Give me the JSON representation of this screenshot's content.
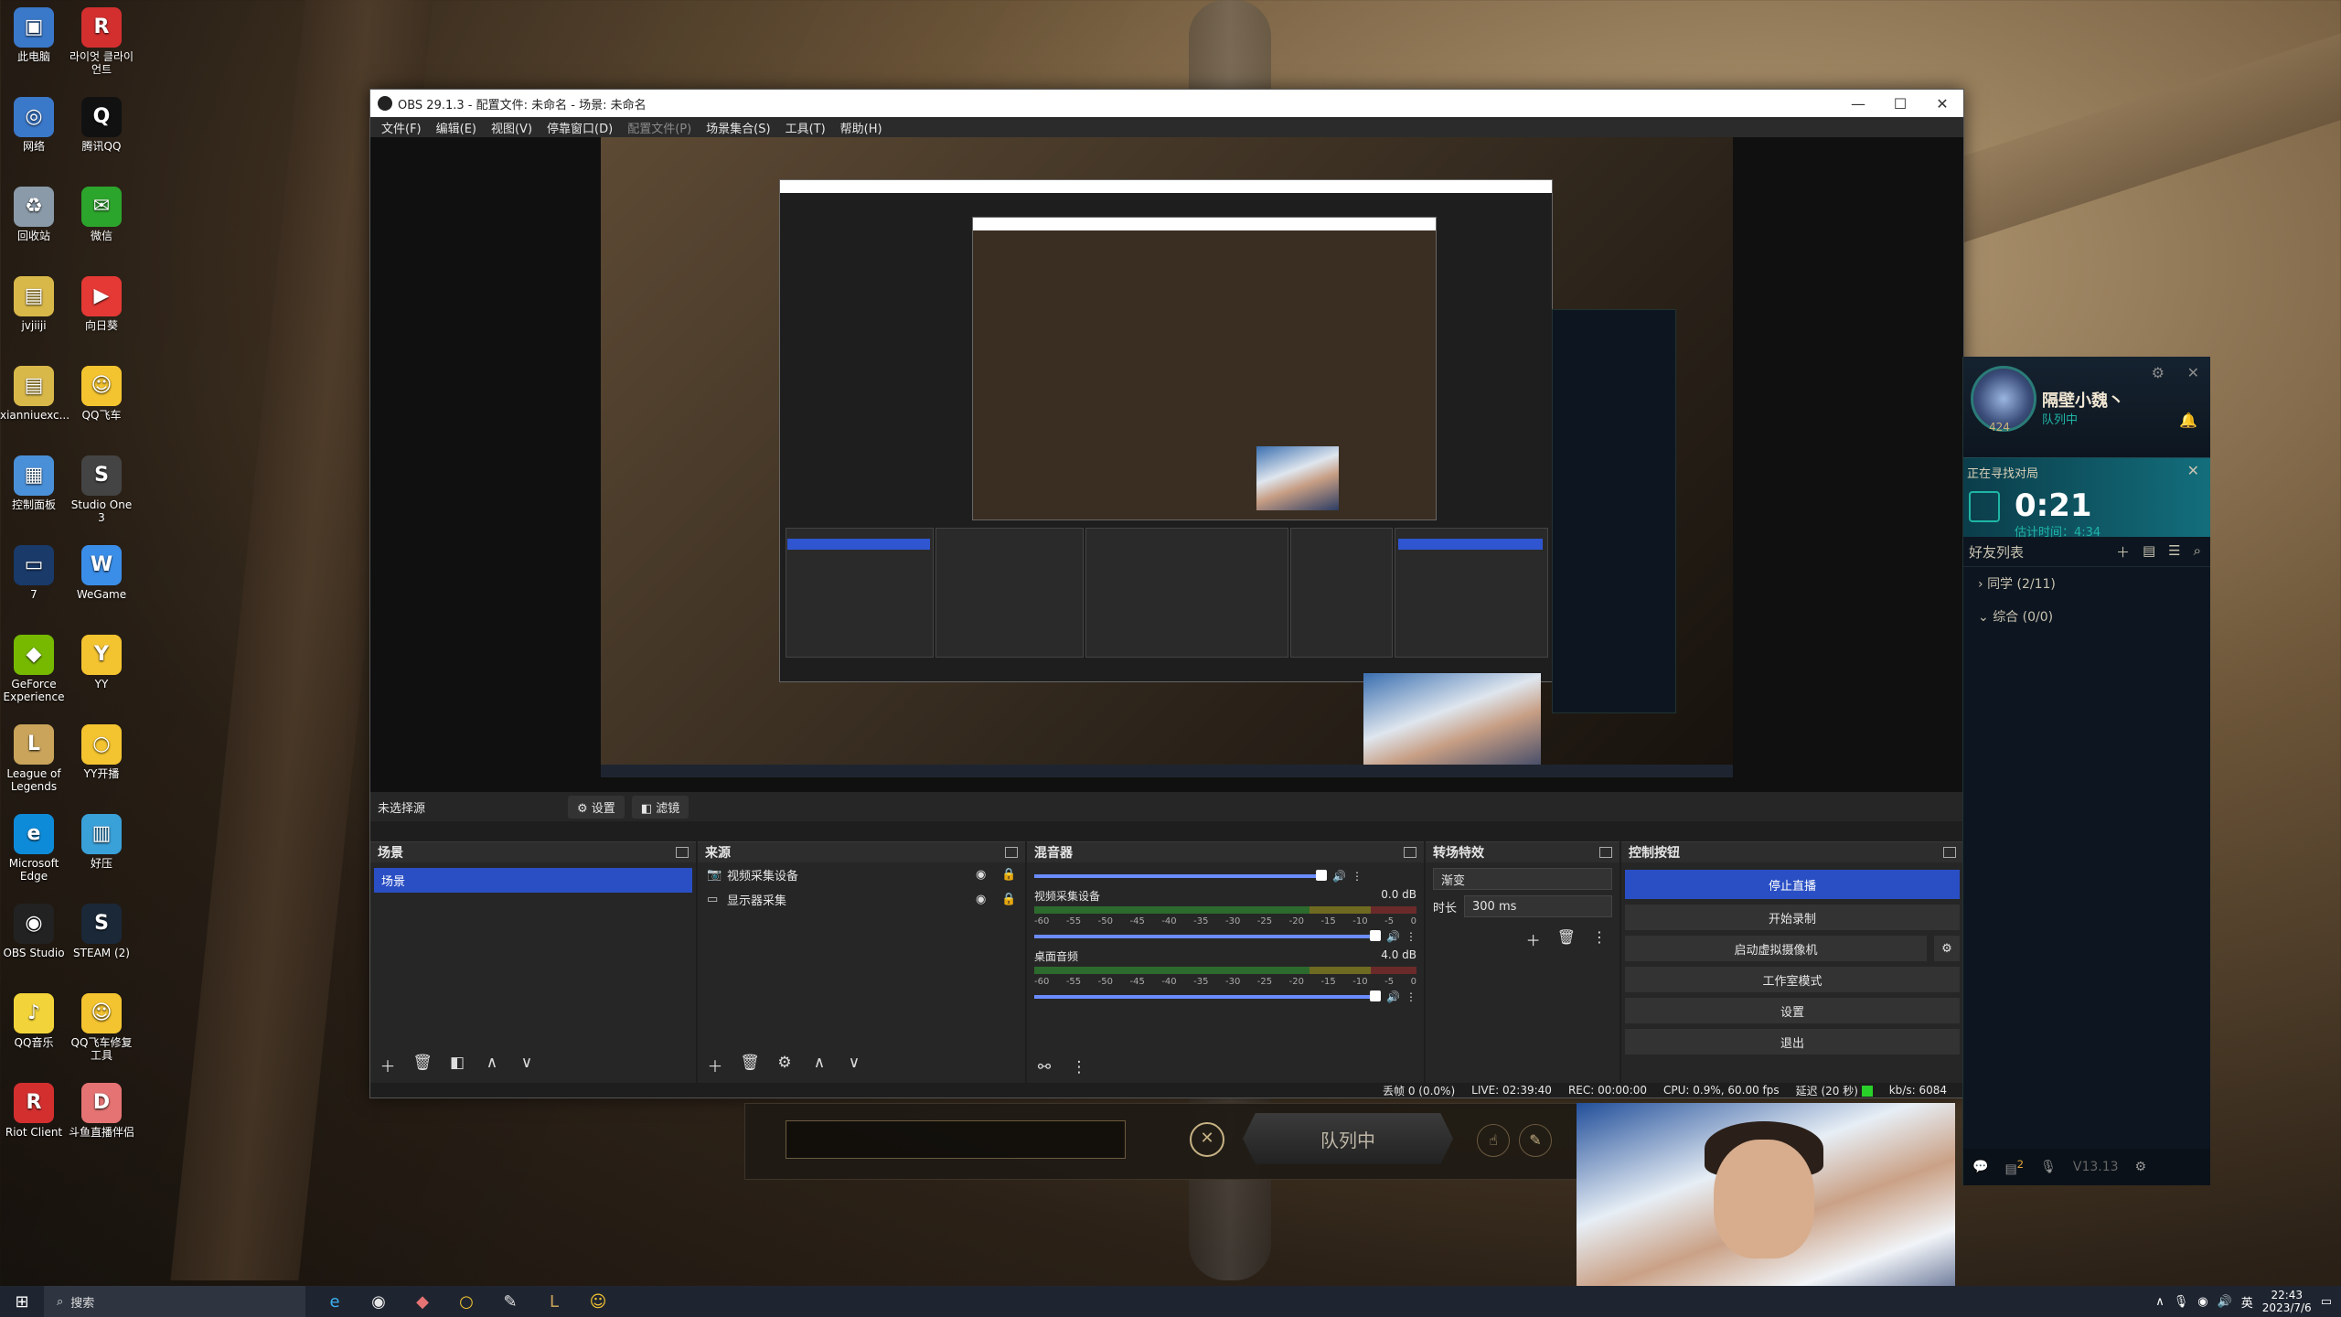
{
  "desktop": {
    "icons": [
      {
        "label": "此电脑",
        "color": "#3a78c9",
        "glyph": "▣"
      },
      {
        "label": "라이엇 클라이언트",
        "color": "#d32f2f",
        "glyph": "R"
      },
      {
        "label": "网络",
        "color": "#3a78c9",
        "glyph": "◎"
      },
      {
        "label": "腾讯QQ",
        "color": "#111111",
        "glyph": "Q"
      },
      {
        "label": "回收站",
        "color": "#8a9aa8",
        "glyph": "♻"
      },
      {
        "label": "微信",
        "color": "#2ca52c",
        "glyph": "✉"
      },
      {
        "label": "jvjiiji",
        "color": "#d9b84a",
        "glyph": "▤"
      },
      {
        "label": "向日葵",
        "color": "#e53935",
        "glyph": "▶"
      },
      {
        "label": "xianniuexc...",
        "color": "#d9b84a",
        "glyph": "▤"
      },
      {
        "label": "QQ飞车",
        "color": "#f4c430",
        "glyph": "☺"
      },
      {
        "label": "控制面板",
        "color": "#4a90d9",
        "glyph": "▦"
      },
      {
        "label": "Studio One 3",
        "color": "#444444",
        "glyph": "S"
      },
      {
        "label": "7",
        "color": "#1a3a6a",
        "glyph": "▭"
      },
      {
        "label": "WeGame",
        "color": "#3b8ee8",
        "glyph": "W"
      },
      {
        "label": "GeForce Experience",
        "color": "#76b900",
        "glyph": "◆"
      },
      {
        "label": "YY",
        "color": "#f4c430",
        "glyph": "Y"
      },
      {
        "label": "League of Legends",
        "color": "#c9a45a",
        "glyph": "L"
      },
      {
        "label": "YY开播",
        "color": "#f4c430",
        "glyph": "○"
      },
      {
        "label": "Microsoft Edge",
        "color": "#0e8bd8",
        "glyph": "e"
      },
      {
        "label": "好压",
        "color": "#3aa0d8",
        "glyph": "▥"
      },
      {
        "label": "OBS Studio",
        "color": "#222222",
        "glyph": "◉"
      },
      {
        "label": "STEAM (2)",
        "color": "#1b2838",
        "glyph": "S"
      },
      {
        "label": "QQ音乐",
        "color": "#f2d43a",
        "glyph": "♪"
      },
      {
        "label": "QQ飞车修复工具",
        "color": "#f4c430",
        "glyph": "☺"
      },
      {
        "label": "Riot Client",
        "color": "#d32f2f",
        "glyph": "R"
      },
      {
        "label": "斗鱼直播伴侣",
        "color": "#e57373",
        "glyph": "D"
      }
    ]
  },
  "obs": {
    "title": "OBS 29.1.3 - 配置文件: 未命名 - 场景: 未命名",
    "menu": [
      "文件(F)",
      "编辑(E)",
      "视图(V)",
      "停靠窗口(D)",
      "配置文件(P)",
      "场景集合(S)",
      "工具(T)",
      "帮助(H)"
    ],
    "source_bar": {
      "label": "未选择源",
      "settings": "设置",
      "filters": "滤镜"
    },
    "scenes": {
      "title": "场景",
      "items": [
        "场景"
      ]
    },
    "sources": {
      "title": "来源",
      "items": [
        "视频采集设备",
        "显示器采集"
      ]
    },
    "mixer": {
      "title": "混音器",
      "tracks": [
        {
          "name": "视频采集设备",
          "db": "0.0 dB",
          "level": 0.95
        },
        {
          "name": "桌面音频",
          "db": "4.0 dB",
          "level": 0.95
        }
      ],
      "ticks": [
        "-60",
        "-55",
        "-50",
        "-45",
        "-40",
        "-35",
        "-30",
        "-25",
        "-20",
        "-15",
        "-10",
        "-5",
        "0"
      ]
    },
    "transitions": {
      "title": "转场特效",
      "selected": "渐变",
      "duration_label": "时长",
      "duration": "300 ms"
    },
    "controls": {
      "title": "控制按钮",
      "buttons": [
        "停止直播",
        "开始录制",
        "启动虚拟摄像机",
        "工作室模式",
        "设置",
        "退出"
      ]
    },
    "status": {
      "dropped": "丢帧 0 (0.0%)",
      "live": "LIVE: 02:39:40",
      "rec": "REC: 00:00:00",
      "cpu": "CPU: 0.9%, 60.00 fps",
      "latency": "延迟 (20 秒)",
      "kbps": "kb/s: 6084"
    }
  },
  "queue": {
    "label": "队列中"
  },
  "client": {
    "name": "隔壁小魏丶",
    "status": "队列中",
    "level": "424",
    "searching": "正在寻找对局",
    "timer": "0:21",
    "estimate": "估计时间：4:34",
    "friends": "好友列表",
    "groups": [
      "同学 (2/11)",
      "综合 (0/0)"
    ],
    "badge": "2",
    "version": "V13.13"
  },
  "taskbar": {
    "search": "搜索",
    "ime": "英",
    "time": "22:43",
    "date": "2023/7/6"
  }
}
